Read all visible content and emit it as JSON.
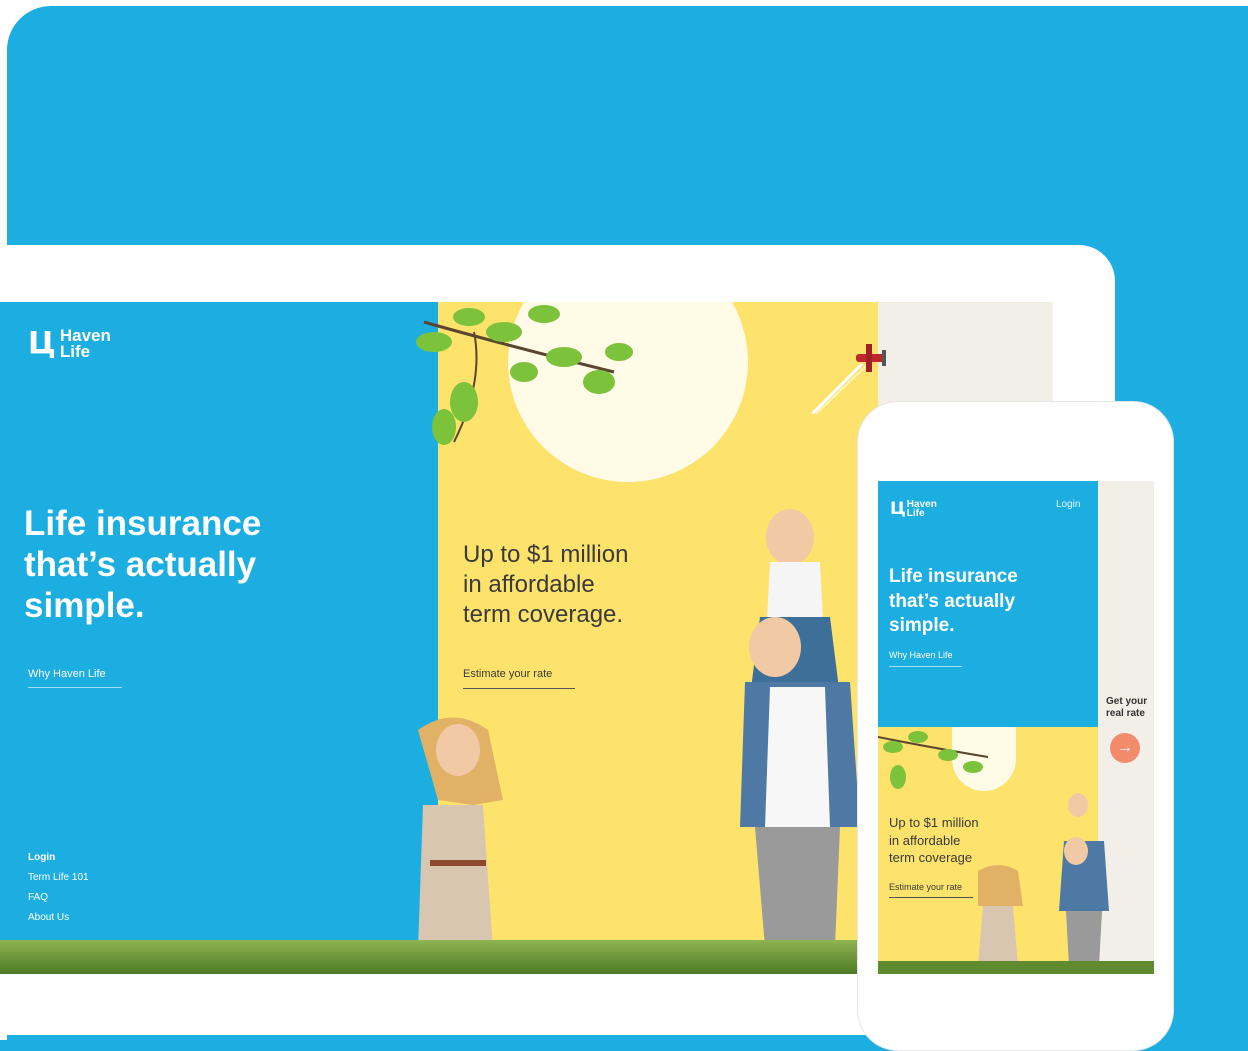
{
  "brand": {
    "name_line1": "Haven",
    "name_line2": "Life",
    "logo_icon": "haven-life-logo-mark"
  },
  "desktop": {
    "hero_title_lines": [
      "Life insurance",
      "that’s actually",
      "simple."
    ],
    "cta_label": "Why Haven Life",
    "yellow_title_lines": [
      "Up to $1 million",
      "in affordable",
      "term coverage."
    ],
    "estimate_label": "Estimate your rate",
    "footer_nav": [
      "Login",
      "Term Life 101",
      "FAQ",
      "About Us"
    ]
  },
  "mobile": {
    "login_label": "Login",
    "hero_title_lines": [
      "Life insurance",
      "that’s actually",
      "simple."
    ],
    "cta_label": "Why Haven Life",
    "yellow_title_lines": [
      "Up to $1 million",
      "in affordable",
      "term coverage"
    ],
    "estimate_label": "Estimate your rate",
    "side_cta_lines": [
      "Get your",
      "real rate"
    ],
    "side_cta_icon": "arrow-right-icon"
  },
  "colors": {
    "brand_blue": "#1caee1",
    "sun_yellow": "#fde36b",
    "accent_coral": "#f28a6c"
  }
}
